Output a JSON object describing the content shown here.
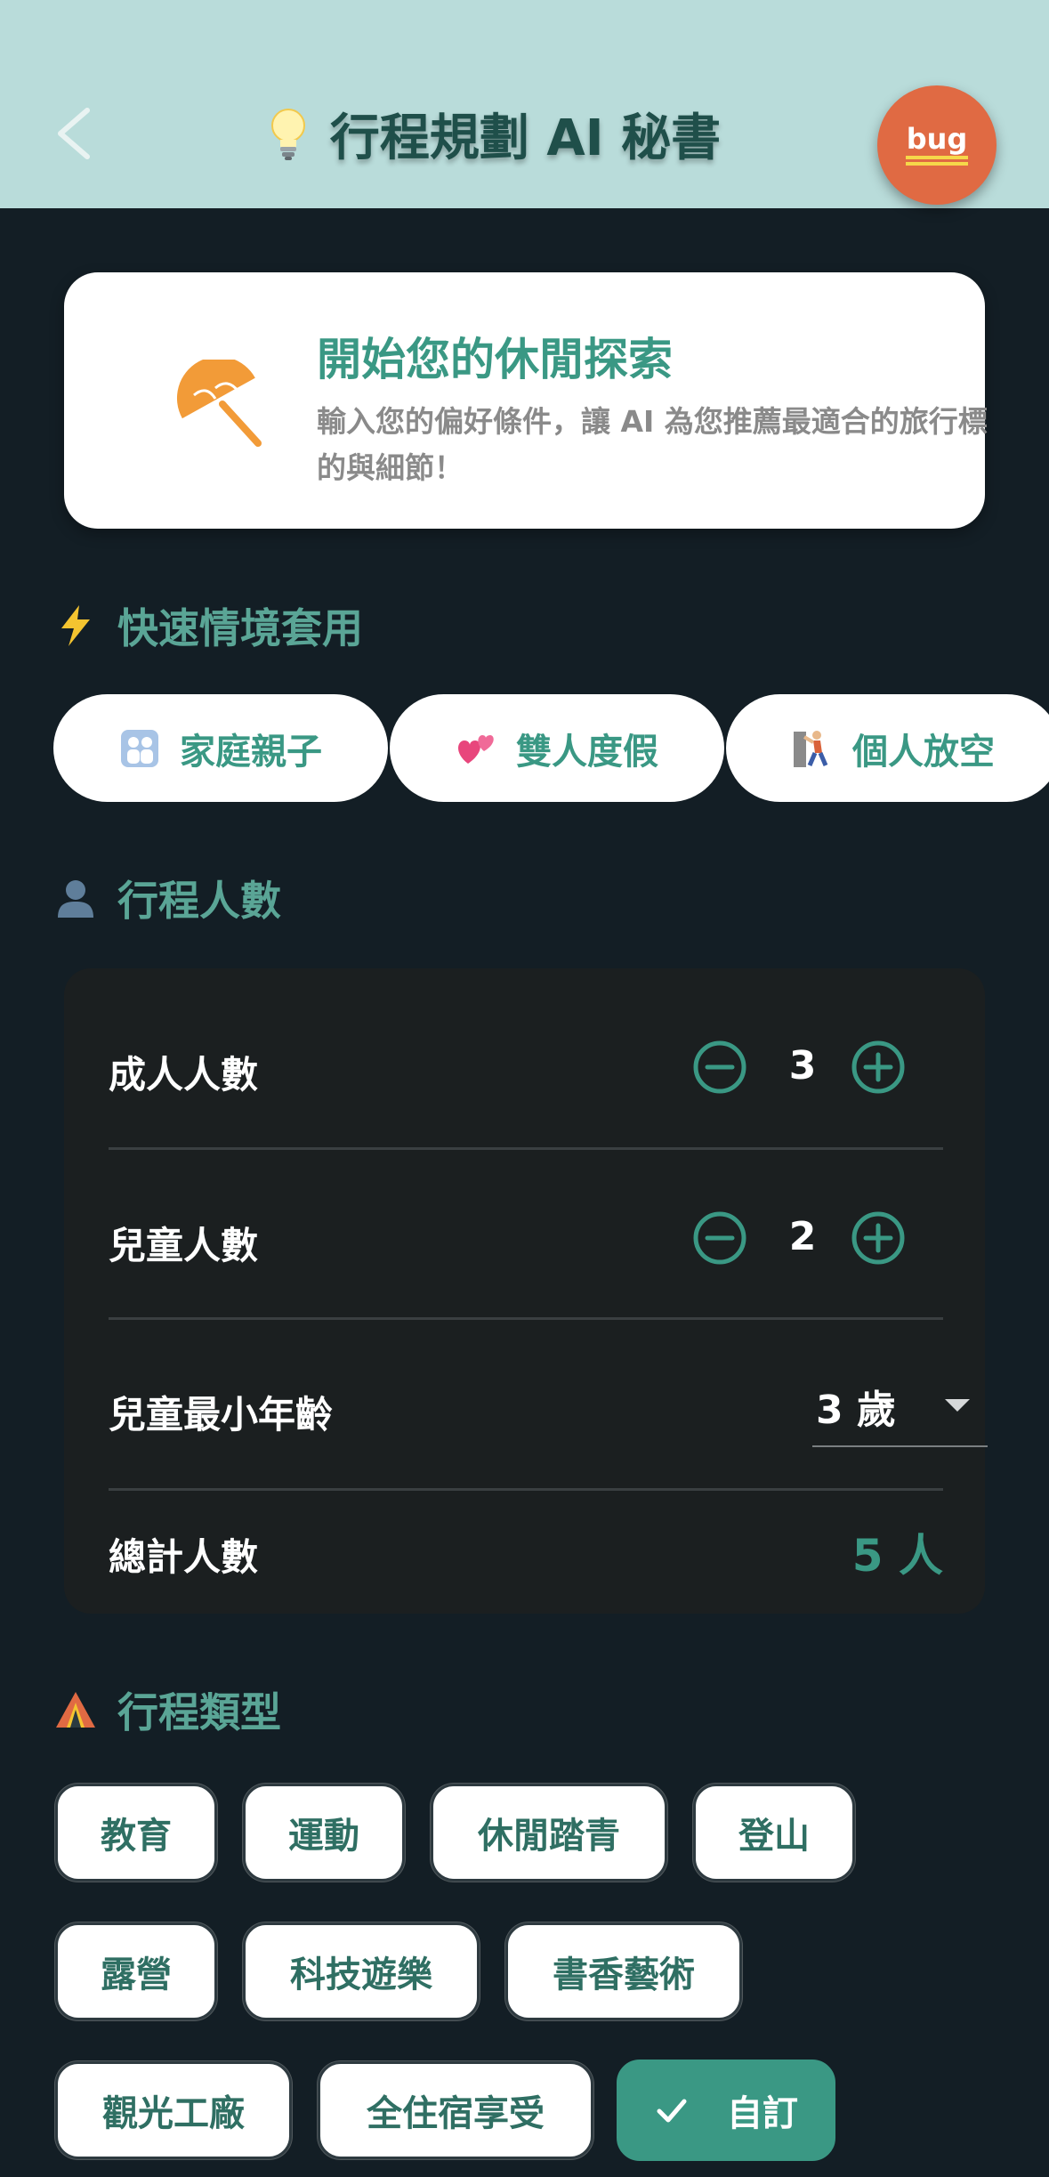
{
  "header": {
    "title": "行程規劃 AI 秘書",
    "back_icon": "chevron-left-icon",
    "title_icon": "lightbulb-icon",
    "bug_label": "bug",
    "colors": {
      "background": "#b9dcda",
      "title": "#1f4f4a",
      "bug_button": "#e06a43"
    }
  },
  "intro": {
    "icon": "umbrella-icon",
    "title": "開始您的休閒探索",
    "description": "輸入您的偏好條件，讓 AI 為您推薦最適合的旅行標的與細節！"
  },
  "quick_scenarios": {
    "title": "快速情境套用",
    "icon": "lightning-icon",
    "items": [
      {
        "label": "家庭親子",
        "icon": "family-icon"
      },
      {
        "label": "雙人度假",
        "icon": "two-hearts-icon"
      },
      {
        "label": "個人放空",
        "icon": "person-climbing-icon"
      }
    ]
  },
  "people": {
    "title": "行程人數",
    "icon": "person-silhouette-icon",
    "adults": {
      "label": "成人人數",
      "value": "3"
    },
    "children": {
      "label": "兒童人數",
      "value": "2"
    },
    "min_child_age": {
      "label": "兒童最小年齡",
      "value": "3 歲"
    },
    "total": {
      "label": "總計人數",
      "value": "5 人"
    }
  },
  "trip_types": {
    "title": "行程類型",
    "icon": "tent-icon",
    "items": [
      {
        "label": "教育",
        "selected": false
      },
      {
        "label": "運動",
        "selected": false
      },
      {
        "label": "休閒踏青",
        "selected": false
      },
      {
        "label": "登山",
        "selected": false
      },
      {
        "label": "露營",
        "selected": false
      },
      {
        "label": "科技遊樂",
        "selected": false
      },
      {
        "label": "書香藝術",
        "selected": false
      },
      {
        "label": "觀光工廠",
        "selected": false
      },
      {
        "label": "全住宿享受",
        "selected": false
      },
      {
        "label": "自訂",
        "selected": true
      }
    ]
  },
  "colors": {
    "accent": "#3a9884",
    "page_background": "#131e25",
    "card_dark": "#1b1f20"
  }
}
